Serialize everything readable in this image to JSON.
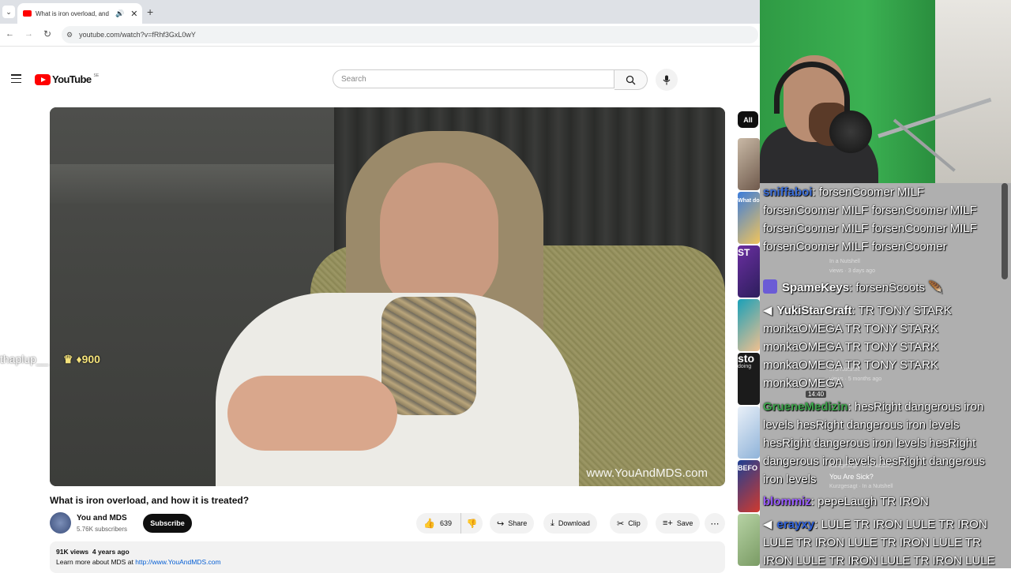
{
  "browser": {
    "tab_title": "What is iron overload, and",
    "url": "youtube.com/watch?v=fRhf3GxL0wY"
  },
  "youtube": {
    "logo": "YouTube",
    "region": "SE",
    "search_placeholder": "Search",
    "chip_all": "All"
  },
  "video": {
    "watermark": "www.YouAndMDS.com",
    "title": "What is iron overload, and how it is treated?",
    "channel": "You and MDS",
    "subscribers": "5.76K subscribers",
    "subscribe_label": "Subscribe",
    "likes": "639",
    "share_label": "Share",
    "download_label": "Download",
    "clip_label": "Clip",
    "save_label": "Save",
    "views": "91K views",
    "age": "4 years ago",
    "desc_prefix": "Learn more about MDS at",
    "desc_link": "http://www.YouAndMDS.com"
  },
  "overlay": {
    "name": "thaplup__",
    "points": "900"
  },
  "sidebar": {
    "thumb_texts": [
      "What do",
      "ST",
      "sto",
      "doing",
      "BEFO"
    ],
    "durations": [
      "14:40"
    ],
    "fragments": [
      "In a Nutshell",
      "views · 3 days ago",
      "In a Nutshell",
      "views · 5 months ago",
      "Kurzgesagt · In a Nutshell",
      "You Are Sick?",
      "Kurzgesagt · In a Nutshell"
    ]
  },
  "chat": [
    {
      "user": "sniffaboi",
      "color": "#3d6fd9",
      "text": ": forsenCoomer MILF forsenCoomer MILF forsenCoomer MILF forsenCoomer MILF forsenCoomer MILF forsenCoomer MILF forsenCoomer"
    },
    {
      "user": "SpameKeys",
      "color": "#ffffff",
      "text": ": forsenScoots"
    },
    {
      "user": "YukiStarCraft",
      "color": "#ffffff",
      "text": ": TR TONY STARK monkaOMEGA TR TONY STARK monkaOMEGA TR TONY STARK monkaOMEGA TR TONY STARK monkaOMEGA"
    },
    {
      "user": "GrueneMedizin",
      "color": "#3fa54d",
      "text": ": hesRight dangerous iron levels hesRight dangerous iron levels hesRight dangerous iron levels hesRight dangerous iron levels hesRight dangerous iron levels"
    },
    {
      "user": "blommiz",
      "color": "#9a5cff",
      "text": ": pepeLaugh TR IRON"
    },
    {
      "user": "erayxy",
      "color": "#2f62d9",
      "text": ": LULE TR IRON LULE TR IRON LULE TR IRON LULE TR IRON LULE TR IRON LULE TR IRON LULE TR IRON LULE"
    }
  ]
}
